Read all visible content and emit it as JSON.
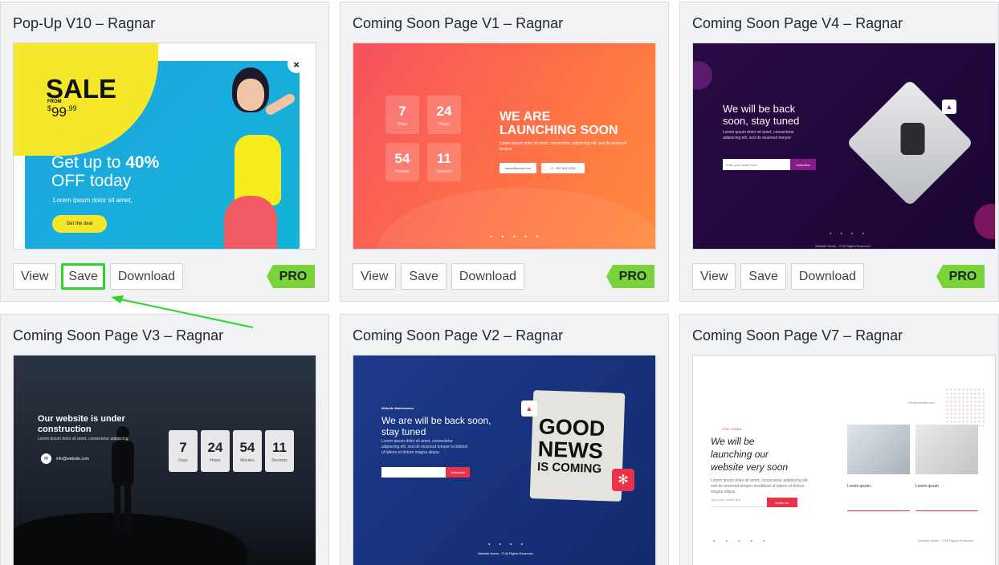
{
  "cards": [
    {
      "title": "Pop-Up V10 – Ragnar",
      "thumb": {
        "close": "×",
        "sale": "SALE",
        "from": "FROM",
        "price_currency": "$",
        "price_main": "99",
        "price_cents": ".99",
        "headline_pre": "Get up to",
        "headline_pct": "40%",
        "headline_post": "OFF today",
        "body": "Lorem ipsum dolor sit amet,",
        "cta": "Get the deal"
      },
      "actions": {
        "view": "View",
        "save": "Save",
        "download": "Download"
      },
      "badge": "PRO"
    },
    {
      "title": "Coming Soon Page V1 – Ragnar",
      "thumb": {
        "counters": [
          {
            "value": "7",
            "label": "Days"
          },
          {
            "value": "24",
            "label": "Hours"
          },
          {
            "value": "54",
            "label": "Minutes"
          },
          {
            "value": "11",
            "label": "Seconds"
          }
        ],
        "headline_1": "WE ARE",
        "headline_2": "LAUNCHING SOON",
        "body": "Lorem ipsum dolor sit amet, consectetur adipiscing elit, sed do eiusmod tempor",
        "email": "name@email.com",
        "phone": "987 654 3789"
      },
      "actions": {
        "view": "View",
        "save": "Save",
        "download": "Download"
      },
      "badge": "PRO"
    },
    {
      "title": "Coming Soon Page V4 – Ragnar",
      "thumb": {
        "headline_1": "We will be back",
        "headline_2": "soon, stay tuned",
        "body": "Lorem ipsum dolor sit amet, consectetur adipiscing elit, sed do eiusmod tempor",
        "placeholder": "Enter your email here...",
        "subscribe": "Subscribe",
        "footer": "Website Name - © All Rights Reserved."
      },
      "actions": {
        "view": "View",
        "save": "Save",
        "download": "Download"
      },
      "badge": "PRO"
    },
    {
      "title": "Coming Soon Page V3 – Ragnar",
      "thumb": {
        "headline_1": "Our website is under",
        "headline_2": "construction",
        "body": "Lorem ipsum dolor sit amet, consectetur adipiscing",
        "email": "info@website.com",
        "counters": [
          {
            "value": "7",
            "label": "Days"
          },
          {
            "value": "24",
            "label": "Hours"
          },
          {
            "value": "54",
            "label": "Minutes"
          },
          {
            "value": "11",
            "label": "Seconds"
          }
        ]
      }
    },
    {
      "title": "Coming Soon Page V2 – Ragnar",
      "thumb": {
        "eyebrow": "Website Maintenance",
        "headline_1": "We are will be back soon,",
        "headline_2": "stay tuned",
        "body": "Lorem ipsum dolor sit amet, consectetur adipiscing elit, sed do eiusmod tempor incididunt ut labore et dolore magna aliqua.",
        "subscribe": "Subscribe",
        "sign_1": "GOOD",
        "sign_2": "NEWS",
        "sign_3": "IS COMING",
        "footer": "Website Name - © All Rights Reserved."
      }
    },
    {
      "title": "Coming Soon Page V7 – Ragnar",
      "thumb": {
        "eyebrow": "STAY TUNED",
        "headline_1": "We will be",
        "headline_2": "launching our",
        "headline_3": "website very soon",
        "body": "Lorem ipsum dolor sit amet, consectetur adipiscing elit, sed do eiusmod tempor incididunt ut labore et dolore magna aliqua.",
        "placeholder": "Type your email here",
        "notify": "Notify me",
        "col_1": "Lorem ipsum",
        "col_2": "Lorem ipsum",
        "email": "info@website.com",
        "footer": "Website Name - © All Rights Reserved."
      }
    }
  ],
  "colors": {
    "highlight": "#2bd62b",
    "pro_badge": "#7bd33a",
    "arrow": "#2bd62b"
  },
  "icons": [
    "close-icon",
    "mail-icon",
    "phone-icon",
    "social-icons",
    "arrow-annotation"
  ]
}
